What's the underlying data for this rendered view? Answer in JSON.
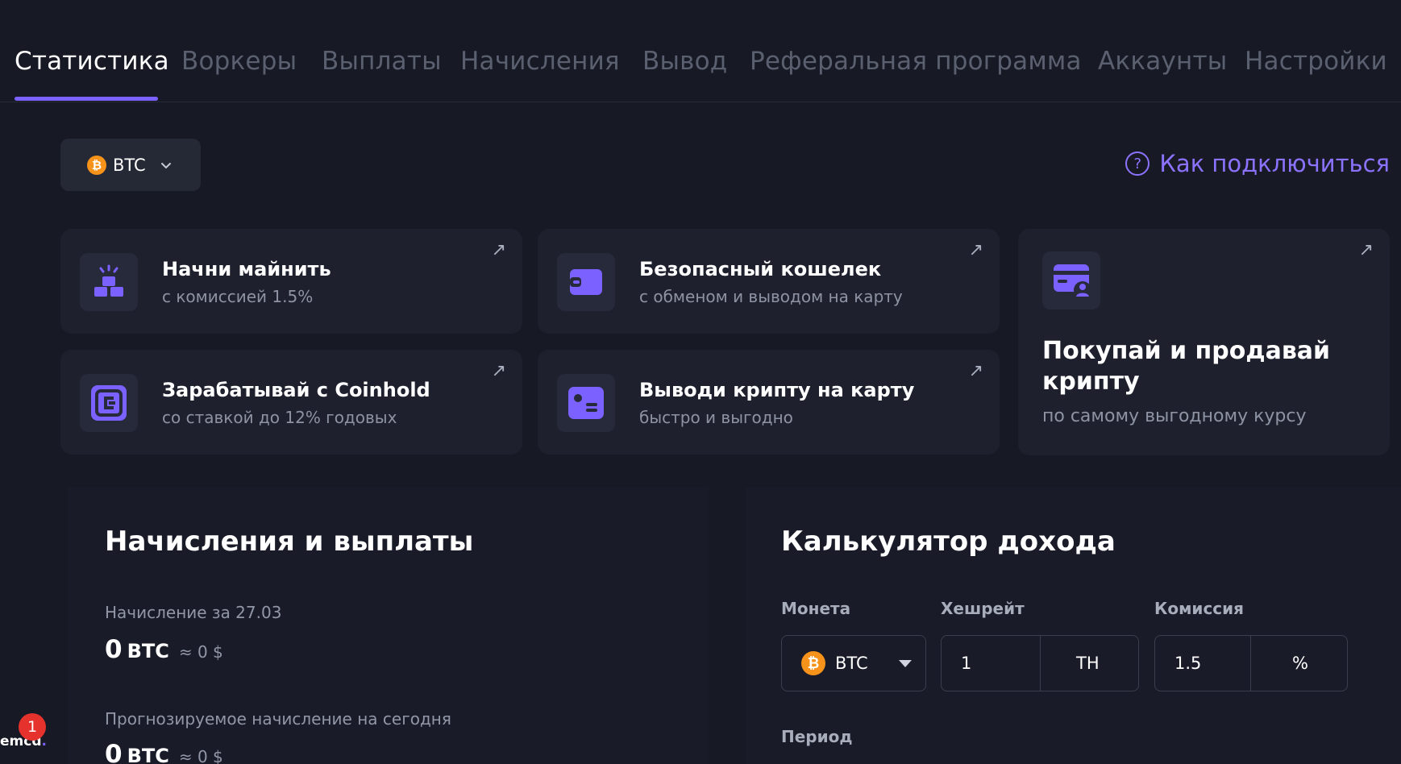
{
  "tabs": [
    {
      "label": "Статистика"
    },
    {
      "label": "Воркеры"
    },
    {
      "label": "Выплаты"
    },
    {
      "label": "Начисления"
    },
    {
      "label": "Вывод"
    },
    {
      "label": "Реферальная программа"
    },
    {
      "label": "Аккаунты"
    },
    {
      "label": "Настройки"
    }
  ],
  "coin_select": {
    "icon": "₿",
    "label": "BTC"
  },
  "how_to_connect": {
    "icon": "?",
    "label": "Как подключиться"
  },
  "cards": [
    {
      "title": "Начни майнить",
      "subtitle": "с комиссией 1.5%",
      "arrow": "↗"
    },
    {
      "title": "Безопасный кошелек",
      "subtitle": "с обменом и выводом на карту",
      "arrow": "↗"
    },
    {
      "title": "Покупай и продавай",
      "title2": "крипту",
      "subtitle": "по самому выгодному курсу",
      "arrow": "↗"
    },
    {
      "title": "Зарабатывай с Coinhold",
      "subtitle": "со ставкой до 12% годовых",
      "arrow": "↗"
    },
    {
      "title": "Выводи крипту на карту",
      "subtitle": "быстро и выгодно",
      "arrow": "↗"
    }
  ],
  "accruals": {
    "title": "Начисления и выплаты",
    "accrual_label": "Начисление за 27.03",
    "accrual_value": "0",
    "accrual_currency": "BTC",
    "accrual_usd": "≈ 0 $",
    "forecast_label": "Прогнозируемое начисление на сегодня",
    "forecast_value": "0",
    "forecast_currency": "BTC",
    "forecast_usd": "≈ 0 $"
  },
  "calculator": {
    "title": "Калькулятор дохода",
    "coin_label": "Монета",
    "coin_value": "BTC",
    "coin_icon": "₿",
    "hashrate_label": "Хешрейт",
    "hashrate_value": "1",
    "hashrate_unit": "TH",
    "fee_label": "Комиссия",
    "fee_value": "1.5",
    "fee_unit": "%",
    "period_label": "Период"
  },
  "badge": {
    "brand": "emcd",
    "brand_dot": ".",
    "notifications": "1"
  },
  "colors": {
    "accent": "#7b61ff",
    "bitcoin": "#f7931a",
    "background": "#171a25",
    "card": "#1e212d",
    "alert": "#e5322d"
  }
}
